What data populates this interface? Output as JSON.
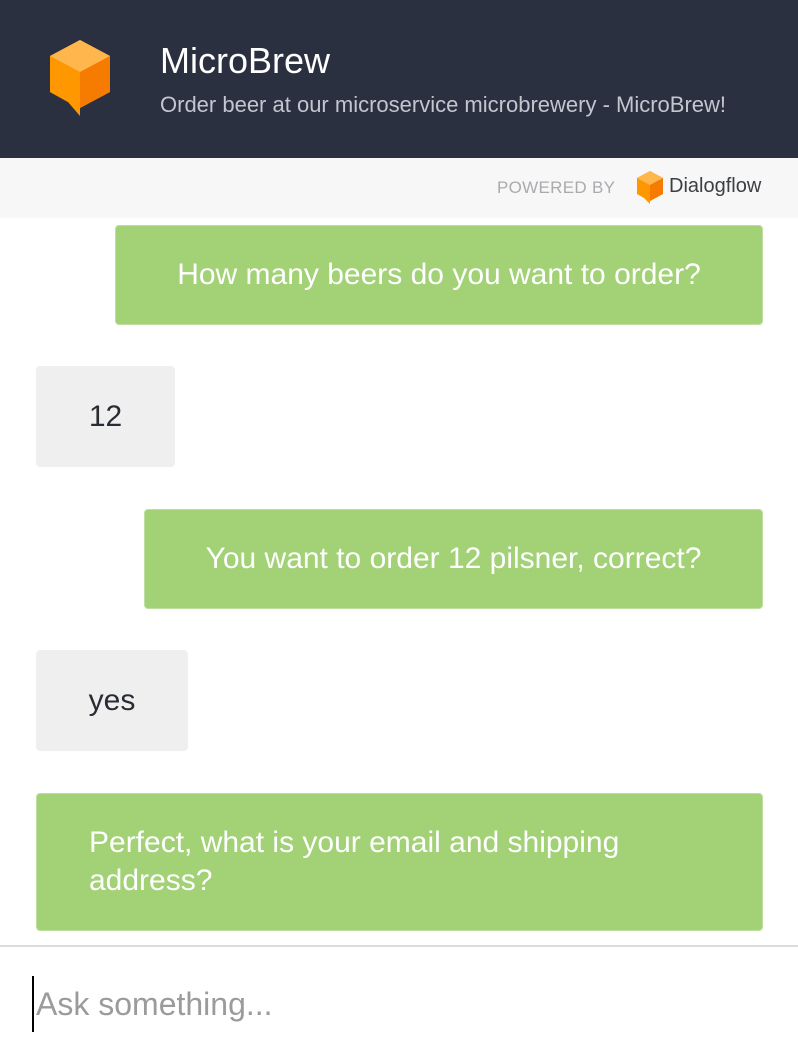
{
  "header": {
    "title": "MicroBrew",
    "subtitle": "Order beer at our microservice microbrewery - MicroBrew!",
    "logo_icon": "dialogflow-cube-icon",
    "logo_color": "#ff9800"
  },
  "powered_by": {
    "label": "POWERED BY",
    "brand": "Dialogflow",
    "brand_icon": "dialogflow-icon"
  },
  "messages": [
    {
      "sender": "bot",
      "text": "How many beers do you want to order?"
    },
    {
      "sender": "user",
      "text": "12"
    },
    {
      "sender": "bot",
      "text": "You want to order 12 pilsner, correct?"
    },
    {
      "sender": "user",
      "text": "yes"
    },
    {
      "sender": "bot",
      "text": "Perfect, what is your email and shipping address?"
    }
  ],
  "input": {
    "placeholder": "Ask something..."
  },
  "colors": {
    "header_bg": "#2b3040",
    "bot_bubble": "#a2d176",
    "user_bubble": "#efefef",
    "accent_orange": "#ff9800"
  }
}
